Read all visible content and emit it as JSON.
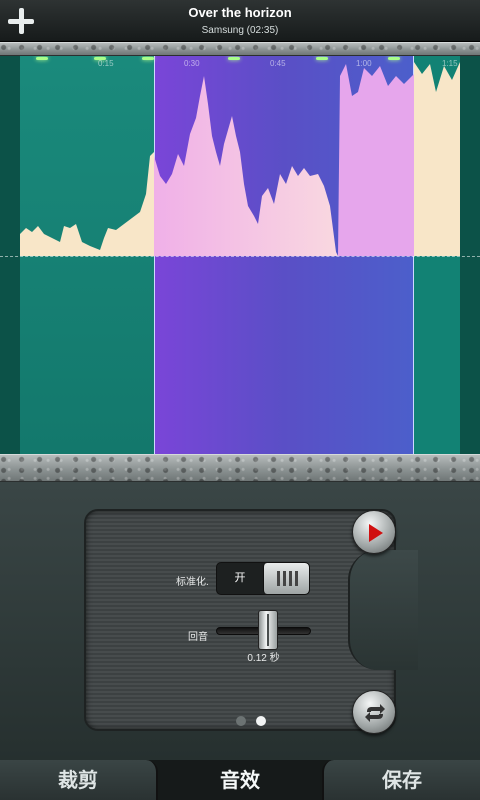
{
  "header": {
    "title": "Over the horizon",
    "subtitle": "Samsung (02:35)"
  },
  "timeline": {
    "ticks": [
      "0:15",
      "0:30",
      "0:45",
      "1:00",
      "1:15"
    ]
  },
  "effects": {
    "normalize_label": "标准化.",
    "normalize_state": "开",
    "echo_label": "回音",
    "echo_value": "0.12 秒",
    "echo_level": 0.55
  },
  "tabs": [
    "裁剪",
    "音效",
    "保存"
  ],
  "colors": {
    "selection": "#6a4ad4",
    "wave_fill": "#f8e6c8",
    "play_icon": "#d01010"
  },
  "icons": {
    "add": "plus-icon",
    "play": "play-icon",
    "loop": "loop-icon"
  }
}
